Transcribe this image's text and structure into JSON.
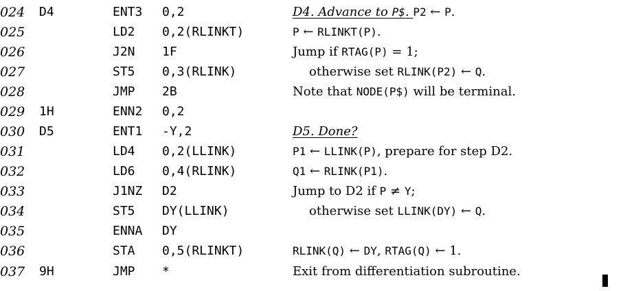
{
  "lines": [
    {
      "num": "024",
      "label": "D4",
      "op": "ENT3",
      "addr": "0,2",
      "c1": "D4. Advance to ",
      "c2": "P$",
      "c3": ". ",
      "c4": "P2",
      "c5": " ← ",
      "c6": "P",
      "c7": "."
    },
    {
      "num": "025",
      "label": "",
      "op": "LD2",
      "addr": "0,2(RLINKT)",
      "c1": "P",
      "c2": " ← ",
      "c3": "RLINKT(P)",
      "c4": "."
    },
    {
      "num": "026",
      "label": "",
      "op": "J2N",
      "addr": "1F",
      "c1": "Jump if ",
      "c2": "RTAG(P)",
      "c3": " = 1;"
    },
    {
      "num": "027",
      "label": "",
      "op": "ST5",
      "addr": "0,3(RLINK)",
      "c1": "otherwise set ",
      "c2": "RLINK(P2)",
      "c3": " ← ",
      "c4": "Q",
      "c5": "."
    },
    {
      "num": "028",
      "label": "",
      "op": "JMP",
      "addr": "2B",
      "c1": "Note that ",
      "c2": "NODE(P$)",
      "c3": " will be terminal."
    },
    {
      "num": "029",
      "label": "1H",
      "op": "ENN2",
      "addr": "0,2"
    },
    {
      "num": "030",
      "label": "D5",
      "op": "ENT1",
      "addr": "-Y,2",
      "c1": "D5. Done?"
    },
    {
      "num": "031",
      "label": "",
      "op": "LD4",
      "addr": "0,2(LLINK)",
      "c1": "P1",
      "c2": " ← ",
      "c3": "LLINK(P)",
      "c4": ", prepare for step D2."
    },
    {
      "num": "032",
      "label": "",
      "op": "LD6",
      "addr": "0,4(RLINK)",
      "c1": "Q1",
      "c2": " ← ",
      "c3": "RLINK(P1)",
      "c4": "."
    },
    {
      "num": "033",
      "label": "",
      "op": "J1NZ",
      "addr": "D2",
      "c1": "Jump to D2 if ",
      "c2": "P",
      "c3": " ≠ ",
      "c4": "Y",
      "c5": ";"
    },
    {
      "num": "034",
      "label": "",
      "op": "ST5",
      "addr": "DY(LLINK)",
      "c1": "otherwise set ",
      "c2": "LLINK(DY)",
      "c3": " ← ",
      "c4": "Q",
      "c5": "."
    },
    {
      "num": "035",
      "label": "",
      "op": "ENNA",
      "addr": "DY"
    },
    {
      "num": "036",
      "label": "",
      "op": "STA",
      "addr": "0,5(RLINKT)",
      "c1": "RLINK(Q)",
      "c2": " ← ",
      "c3": "DY",
      "c4": ", ",
      "c5": "RTAG(Q)",
      "c6": " ← 1."
    },
    {
      "num": "037",
      "label": "9H",
      "op": "JMP",
      "addr": "*",
      "c1": "Exit from differentiation subroutine."
    }
  ]
}
